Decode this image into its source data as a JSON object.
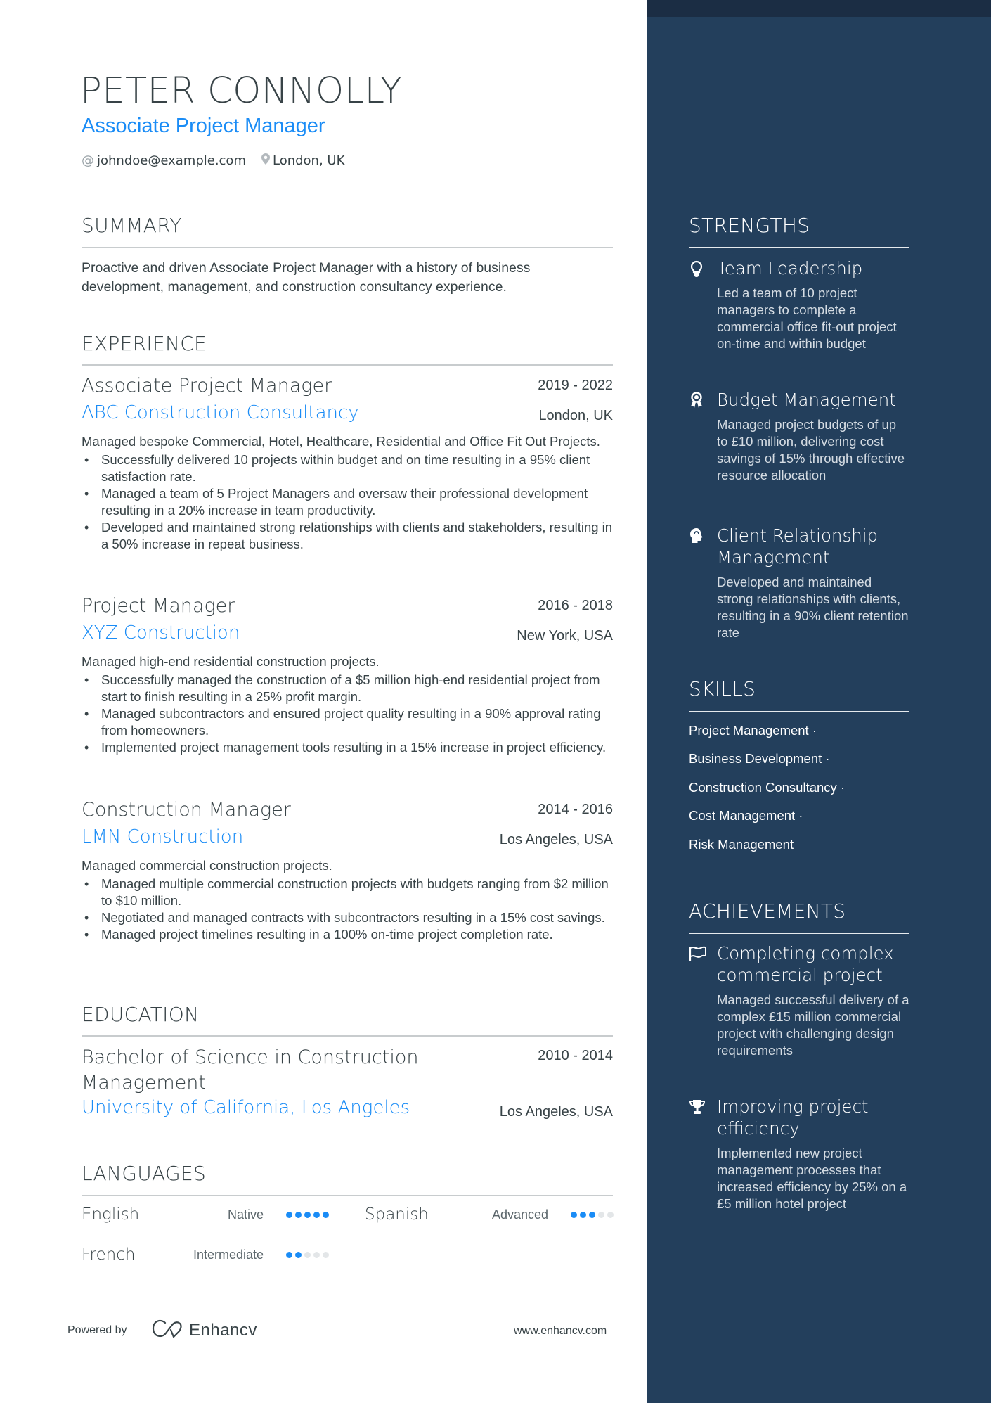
{
  "header": {
    "name": "PETER CONNOLLY",
    "title": "Associate Project Manager",
    "email": "johndoe@example.com",
    "location": "London, UK",
    "email_icon": "at-icon",
    "location_icon": "map-pin-icon"
  },
  "summary": {
    "heading": "SUMMARY",
    "text": "Proactive and driven Associate Project Manager with a history of business development, management, and construction consultancy experience."
  },
  "experience": {
    "heading": "EXPERIENCE",
    "jobs": [
      {
        "role": "Associate Project Manager",
        "dates": "2019 - 2022",
        "company": "ABC Construction Consultancy",
        "location": "London, UK",
        "description": "Managed bespoke Commercial, Hotel, Healthcare, Residential and Office Fit Out Projects.",
        "bullets": [
          "Successfully delivered 10 projects within budget and on time resulting in a 95% client satisfaction rate.",
          "Managed a team of 5 Project Managers and oversaw their professional development resulting in a 20% increase in team productivity.",
          "Developed and maintained strong relationships with clients and stakeholders, resulting in a 50% increase in repeat business."
        ]
      },
      {
        "role": "Project Manager",
        "dates": "2016 - 2018",
        "company": "XYZ Construction",
        "location": "New York, USA",
        "description": "Managed high-end residential construction projects.",
        "bullets": [
          "Successfully managed the construction of a $5 million high-end residential project from start to finish resulting in a 25% profit margin.",
          "Managed subcontractors and ensured project quality resulting in a 90% approval rating from homeowners.",
          "Implemented project management tools resulting in a 15% increase in project efficiency."
        ]
      },
      {
        "role": "Construction Manager",
        "dates": "2014 - 2016",
        "company": "LMN Construction",
        "location": "Los Angeles, USA",
        "description": "Managed commercial construction projects.",
        "bullets": [
          "Managed multiple commercial construction projects with budgets ranging from $2 million to $10 million.",
          "Negotiated and managed contracts with subcontractors resulting in a 15% cost savings.",
          "Managed project timelines resulting in a 100% on-time project completion rate."
        ]
      }
    ]
  },
  "education": {
    "heading": "EDUCATION",
    "degree": "Bachelor of Science in Construction Management",
    "dates": "2010 - 2014",
    "school": "University of California, Los Angeles",
    "location": "Los Angeles, USA"
  },
  "languages": {
    "heading": "LANGUAGES",
    "items": [
      {
        "name": "English",
        "level": "Native",
        "rating": 5,
        "max": 5
      },
      {
        "name": "Spanish",
        "level": "Advanced",
        "rating": 3,
        "max": 5
      },
      {
        "name": "French",
        "level": "Intermediate",
        "rating": 2,
        "max": 5
      }
    ]
  },
  "footer": {
    "powered_by": "Powered by",
    "brand": "Enhancv",
    "url": "www.enhancv.com"
  },
  "strengths": {
    "heading": "STRENGTHS",
    "items": [
      {
        "icon": "lightbulb-icon",
        "title": "Team Leadership",
        "description": "Led a team of 10 project managers to complete a commercial office fit-out project on-time and within budget"
      },
      {
        "icon": "award-medal-icon",
        "title": "Budget Management",
        "description": "Managed project budgets of up to £10 million, delivering cost savings of 15% through effective resource allocation"
      },
      {
        "icon": "head-profile-icon",
        "title": "Client Relationship Management",
        "description": "Developed and maintained strong relationships with clients, resulting in a 90% client retention rate"
      }
    ]
  },
  "skills": {
    "heading": "SKILLS",
    "items": [
      "Project Management ·",
      "Business Development ·",
      "Construction Consultancy ·",
      "Cost Management ·",
      "Risk Management"
    ]
  },
  "achievements": {
    "heading": "ACHIEVEMENTS",
    "items": [
      {
        "icon": "flag-icon",
        "title": "Completing complex commercial project",
        "description": "Managed successful delivery of a complex £15 million commercial project with challenging design requirements"
      },
      {
        "icon": "trophy-icon",
        "title": "Improving project efficiency",
        "description": "Implemented new project management processes that increased efficiency by 25% on a £5 million hotel project"
      }
    ]
  },
  "colors": {
    "accent": "#1a8cf6",
    "sidebar_bg": "#233f5c",
    "sidebar_top": "#1b2d44",
    "text": "#384347",
    "dot_inactive": "#e3e6e8"
  }
}
